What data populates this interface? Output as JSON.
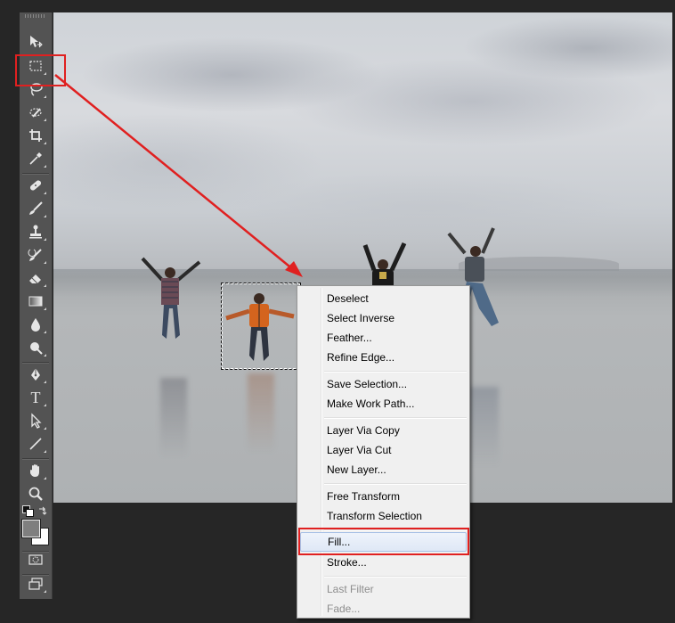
{
  "toolbar": {
    "tools": [
      {
        "name": "move-tool",
        "icon": "move-icon"
      },
      {
        "name": "rectangular-marquee-tool",
        "icon": "marquee-icon"
      },
      {
        "name": "lasso-tool",
        "icon": "lasso-icon"
      },
      {
        "name": "quick-selection-tool",
        "icon": "quick-selection-icon"
      },
      {
        "name": "crop-tool",
        "icon": "crop-icon"
      },
      {
        "name": "eyedropper-tool",
        "icon": "eyedropper-icon"
      },
      {
        "name": "healing-brush-tool",
        "icon": "bandage-icon"
      },
      {
        "name": "brush-tool",
        "icon": "brush-icon"
      },
      {
        "name": "clone-stamp-tool",
        "icon": "stamp-icon"
      },
      {
        "name": "history-brush-tool",
        "icon": "history-brush-icon"
      },
      {
        "name": "eraser-tool",
        "icon": "eraser-icon"
      },
      {
        "name": "gradient-tool",
        "icon": "gradient-icon"
      },
      {
        "name": "blur-tool",
        "icon": "drop-icon"
      },
      {
        "name": "dodge-tool",
        "icon": "dodge-icon"
      },
      {
        "name": "pen-tool",
        "icon": "pen-icon"
      },
      {
        "name": "type-tool",
        "icon": "type-icon",
        "glyph": "T"
      },
      {
        "name": "path-selection-tool",
        "icon": "arrow-icon"
      },
      {
        "name": "line-tool",
        "icon": "line-icon"
      },
      {
        "name": "hand-tool",
        "icon": "hand-icon"
      },
      {
        "name": "zoom-tool",
        "icon": "magnifier-icon"
      }
    ],
    "foreground_color": "#7f7f7f",
    "background_color": "#ffffff"
  },
  "context_menu": {
    "groups": [
      [
        "Deselect",
        "Select Inverse",
        "Feather...",
        "Refine Edge..."
      ],
      [
        "Save Selection...",
        "Make Work Path..."
      ],
      [
        "Layer Via Copy",
        "Layer Via Cut",
        "New Layer..."
      ],
      [
        "Free Transform",
        "Transform Selection"
      ],
      [
        "Fill...",
        "Stroke..."
      ],
      [
        "Last Filter",
        "Fade..."
      ]
    ],
    "items": {
      "deselect": "Deselect",
      "select_inverse": "Select Inverse",
      "feather": "Feather...",
      "refine_edge": "Refine Edge...",
      "save_selection": "Save Selection...",
      "make_work_path": "Make Work Path...",
      "layer_via_copy": "Layer Via Copy",
      "layer_via_cut": "Layer Via Cut",
      "new_layer": "New Layer...",
      "free_transform": "Free Transform",
      "transform_selection": "Transform Selection",
      "fill": "Fill...",
      "stroke": "Stroke...",
      "last_filter": "Last Filter",
      "fade": "Fade..."
    },
    "highlighted": "Fill...",
    "disabled": [
      "Last Filter",
      "Fade..."
    ]
  },
  "annotation": {
    "color": "#e02020",
    "highlight_targets": [
      "rectangular-marquee-tool",
      "Fill..."
    ]
  }
}
